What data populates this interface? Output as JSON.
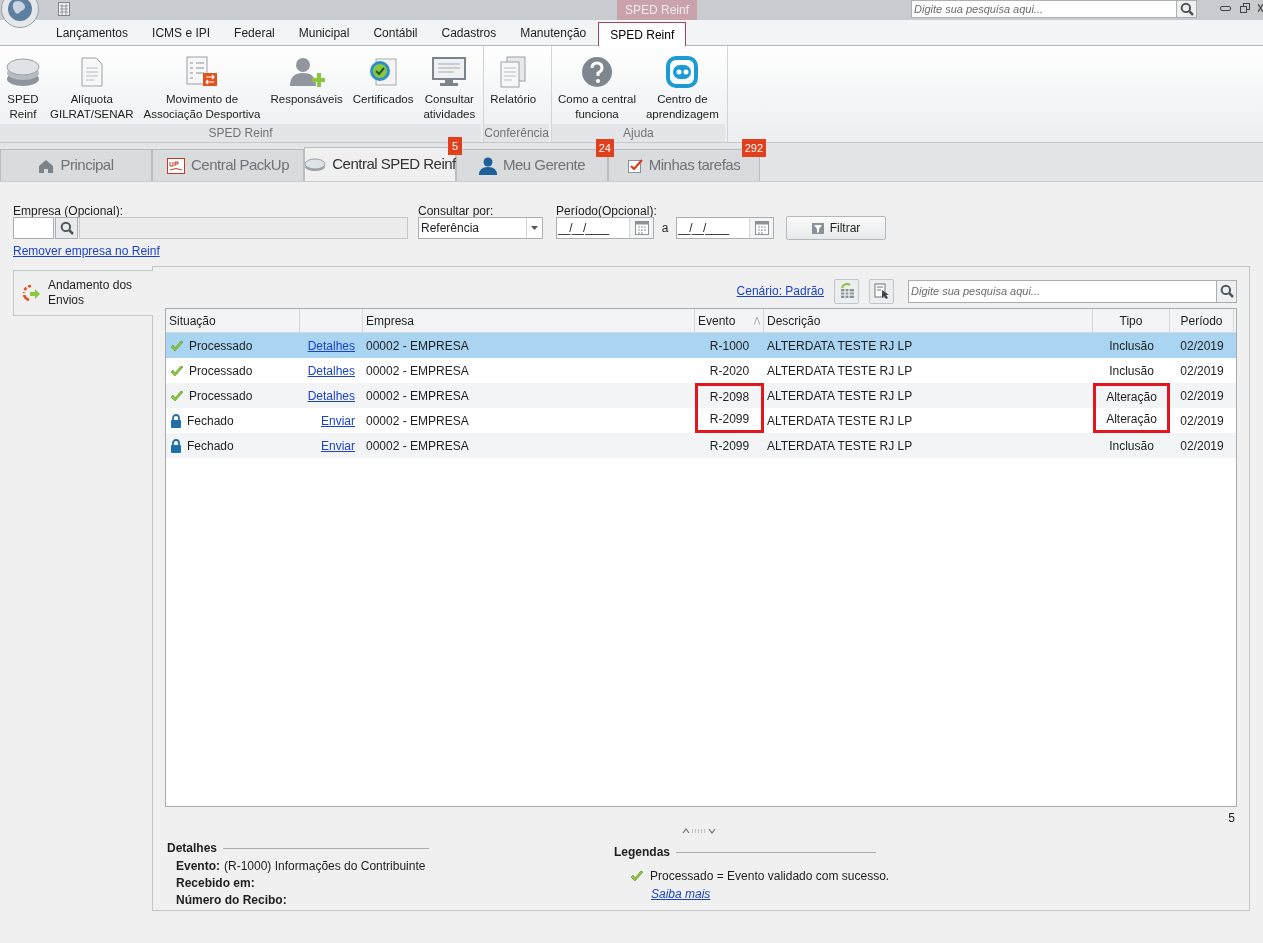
{
  "app_bar": {
    "context_tab": "SPED Reinf",
    "search": {
      "placeholder": "Digite sua pesquisa aqui..."
    }
  },
  "ribbon_tabs": [
    {
      "label": "Lançamentos",
      "selected": false
    },
    {
      "label": "ICMS e IPI",
      "selected": false
    },
    {
      "label": "Federal",
      "selected": false
    },
    {
      "label": "Municipal",
      "selected": false
    },
    {
      "label": "Contábil",
      "selected": false
    },
    {
      "label": "Cadastros",
      "selected": false
    },
    {
      "label": "Manutenção",
      "selected": false
    },
    {
      "label": "SPED Reinf",
      "selected": true
    }
  ],
  "ribbon_groups": [
    {
      "label": "SPED Reinf",
      "buttons": [
        {
          "label": "SPED\nReinf",
          "kind": "disc"
        },
        {
          "label": "Alíquota\nGILRAT/SENAR",
          "kind": "document"
        },
        {
          "label": "Movimento de\nAssociação Desportiva",
          "kind": "list"
        },
        {
          "label": "Responsáveis",
          "kind": "person"
        },
        {
          "label": "Certificados",
          "kind": "certificate"
        },
        {
          "label": "Consultar\natividades",
          "kind": "monitor"
        }
      ]
    },
    {
      "label": "Conferência",
      "buttons": [
        {
          "label": "Relatório",
          "kind": "pages"
        }
      ]
    },
    {
      "label": "Ajuda",
      "buttons": [
        {
          "label": "Como a central\nfunciona",
          "kind": "help"
        },
        {
          "label": "Centro de\naprendizagem",
          "kind": "learn"
        }
      ]
    }
  ],
  "document_tabs": [
    {
      "label": "Principal",
      "kind": "home",
      "selected": false
    },
    {
      "label": "Central PackUp",
      "kind": "up",
      "selected": false
    },
    {
      "label": "Central SPED Reinf",
      "kind": "disc",
      "selected": true,
      "badge": "5"
    },
    {
      "label": "Meu Gerente",
      "kind": "person",
      "selected": false,
      "badge": "24"
    },
    {
      "label": "Minhas tarefas",
      "kind": "check",
      "selected": false,
      "badge": "292"
    }
  ],
  "filters": {
    "empresa_label": "Empresa (Opcional):",
    "remove_link": "Remover empresa no Reinf",
    "consultar_label": "Consultar por:",
    "consultar_value": "Referência",
    "periodo_label": "Período(Opcional):",
    "date_from": "__/__/____",
    "separator": "a",
    "date_to": "__/__/____",
    "filter_button": "Filtrar"
  },
  "side_tabs": [
    {
      "label": "Andamento dos Envios",
      "selected": true
    }
  ],
  "grid": {
    "scenario_link": "Cenário: Padrão",
    "search": {
      "placeholder": "Digite sua pesquisa aqui..."
    },
    "columns": [
      {
        "label": "Situação",
        "sorted": false
      },
      {
        "sorted": false
      },
      {
        "label": "Empresa",
        "sorted": false
      },
      {
        "label": "Evento",
        "sorted": true
      },
      {
        "label": "Descrição",
        "sorted": false
      },
      {
        "label": "Tipo",
        "sorted": false
      },
      {
        "label": "Período",
        "sorted": false
      }
    ],
    "rows": [
      {
        "kind": "processed",
        "selected": true,
        "cells": [
          {
            "text": "Processado",
            "marked": false
          },
          {
            "text": "Detalhes",
            "marked": false
          },
          {
            "text": "00002 - EMPRESA",
            "marked": false
          },
          {
            "text": "R-1000",
            "marked": false
          },
          {
            "text": "ALTERDATA TESTE RJ LP",
            "marked": false
          },
          {
            "text": "Inclusão",
            "marked": false
          },
          {
            "text": "02/2019",
            "marked": false
          }
        ]
      },
      {
        "kind": "processed",
        "selected": false,
        "cells": [
          {
            "text": "Processado",
            "marked": false
          },
          {
            "text": "Detalhes",
            "marked": false
          },
          {
            "text": "00002 - EMPRESA",
            "marked": false
          },
          {
            "text": "R-2020",
            "marked": false
          },
          {
            "text": "ALTERDATA TESTE RJ LP",
            "marked": false
          },
          {
            "text": "Inclusão",
            "marked": false
          },
          {
            "text": "02/2019",
            "marked": false
          }
        ]
      },
      {
        "kind": "processed",
        "selected": false,
        "cells": [
          {
            "text": "Processado",
            "marked": false
          },
          {
            "text": "Detalhes",
            "marked": false
          },
          {
            "text": "00002 - EMPRESA",
            "marked": false
          },
          {
            "text": "R-2098",
            "marked": true
          },
          {
            "text": "ALTERDATA TESTE RJ LP",
            "marked": false
          },
          {
            "text": "Alteração",
            "marked": true
          },
          {
            "text": "02/2019",
            "marked": false
          }
        ]
      },
      {
        "kind": "closed",
        "selected": false,
        "cells": [
          {
            "text": "Fechado",
            "marked": false
          },
          {
            "text": "Enviar",
            "marked": false
          },
          {
            "text": "00002 - EMPRESA",
            "marked": false
          },
          {
            "text": "R-2099",
            "marked": true
          },
          {
            "text": "ALTERDATA TESTE RJ LP",
            "marked": false
          },
          {
            "text": "Alteração",
            "marked": true
          },
          {
            "text": "02/2019",
            "marked": false
          }
        ]
      },
      {
        "kind": "closed",
        "selected": false,
        "cells": [
          {
            "text": "Fechado",
            "marked": false
          },
          {
            "text": "Enviar",
            "marked": false
          },
          {
            "text": "00002 - EMPRESA",
            "marked": false
          },
          {
            "text": "R-2099",
            "marked": false
          },
          {
            "text": "ALTERDATA TESTE RJ LP",
            "marked": false
          },
          {
            "text": "Inclusão",
            "marked": false
          },
          {
            "text": "02/2019",
            "marked": false
          }
        ]
      }
    ],
    "row_count": "5"
  },
  "details": {
    "title": "Detalhes",
    "fields": [
      {
        "label": "Evento:",
        "value": "(R-1000) Informações do Contribuinte"
      },
      {
        "label": "Recebido em:"
      },
      {
        "label": "Número do Recibo:"
      }
    ]
  },
  "legend": {
    "title": "Legendas",
    "items": [
      {
        "kind": "processed",
        "text": "Processado = Evento validado com sucesso."
      }
    ],
    "link": "Saiba mais"
  }
}
